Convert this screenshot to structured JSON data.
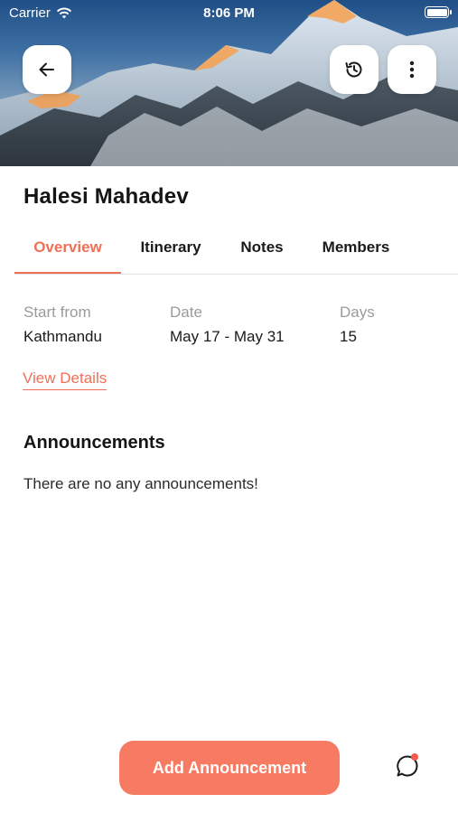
{
  "status_bar": {
    "carrier": "Carrier",
    "time": "8:06 PM"
  },
  "header": {
    "back_icon": "arrow-left-icon",
    "history_icon": "history-icon",
    "more_icon": "more-vertical-icon"
  },
  "trip": {
    "title": "Halesi Mahadev"
  },
  "tabs": [
    {
      "label": "Overview",
      "active": true
    },
    {
      "label": "Itinerary",
      "active": false
    },
    {
      "label": "Notes",
      "active": false
    },
    {
      "label": "Members",
      "active": false
    }
  ],
  "overview": {
    "start_label": "Start from",
    "start_value": "Kathmandu",
    "date_label": "Date",
    "date_value": "May 17 - May 31",
    "days_label": "Days",
    "days_value": "15",
    "view_details": "View Details"
  },
  "announcements": {
    "heading": "Announcements",
    "empty_text": "There are no any announcements!"
  },
  "footer": {
    "add_button": "Add Announcement",
    "chat_icon": "chat-icon",
    "chat_has_notification": true
  },
  "colors": {
    "accent": "#f26f57",
    "button": "#f77a63",
    "muted_text": "#9a9a9a"
  }
}
